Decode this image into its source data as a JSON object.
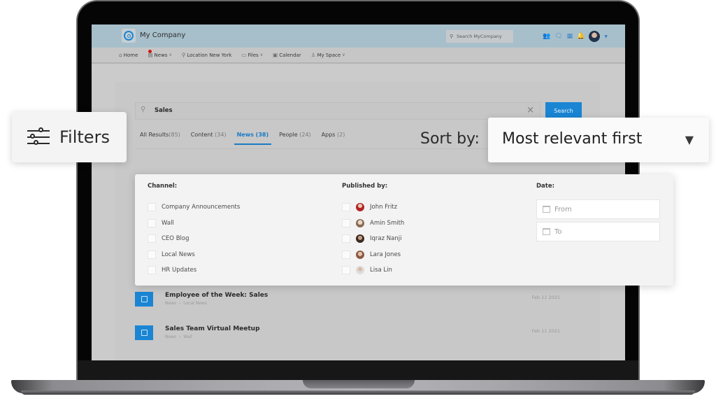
{
  "app": {
    "company_name": "My Company",
    "top_search_placeholder": "Search MyCompany",
    "brand_color": "#1a85d3"
  },
  "nav": {
    "items": [
      {
        "label": "Home",
        "icon": "home-icon",
        "dropdown": false
      },
      {
        "label": "News",
        "icon": "news-icon",
        "dropdown": true,
        "notification": true
      },
      {
        "label": "Location New York",
        "icon": "location-pin-icon",
        "dropdown": false
      },
      {
        "label": "Files",
        "icon": "folder-icon",
        "dropdown": true
      },
      {
        "label": "Calendar",
        "icon": "calendar-icon",
        "dropdown": false
      },
      {
        "label": "My Space",
        "icon": "user-icon",
        "dropdown": true
      }
    ]
  },
  "search": {
    "query": "Sales",
    "button_label": "Search"
  },
  "tabs": [
    {
      "label": "All Results",
      "count": "(85)"
    },
    {
      "label": "Content",
      "count": "(34)"
    },
    {
      "label": "News",
      "count": "(38)",
      "active": true
    },
    {
      "label": "People",
      "count": "(24)"
    },
    {
      "label": "Apps",
      "count": "(2)"
    }
  ],
  "filters_callout": {
    "label": "Filters"
  },
  "sort": {
    "label": "Sort by:",
    "selected": "Most relevant first"
  },
  "filters": {
    "channel": {
      "heading": "Channel:",
      "options": [
        "Company Announcements",
        "Wall",
        "CEO Blog",
        "Local News",
        "HR Updates"
      ]
    },
    "published_by": {
      "heading": "Published by:",
      "options": [
        "John Fritz",
        "Amin Smith",
        "Iqraz Nanji",
        "Lara Jones",
        "Lisa Lin"
      ]
    },
    "date": {
      "heading": "Date:",
      "from_placeholder": "From",
      "to_placeholder": "To"
    }
  },
  "results": [
    {
      "title": "Employee of the Week: Sales",
      "crumb_root": "News",
      "crumb_leaf": "Local News",
      "date": "Feb 11 2021"
    },
    {
      "title": "Sales Team Virtual Meetup",
      "crumb_root": "News",
      "crumb_leaf": "Wall",
      "date": "Feb 11 2021"
    }
  ]
}
